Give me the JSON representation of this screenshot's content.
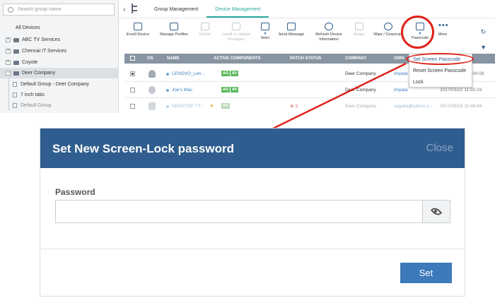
{
  "sidebar": {
    "search_placeholder": "Search group name",
    "all_devices": "All Devices",
    "groups": [
      "ABC TV Services",
      "Chennai IT Services",
      "Coyote",
      "Deer Company"
    ],
    "children": [
      "Default Group - Deer Company",
      "7 inch tabs",
      "Default Group"
    ]
  },
  "tabs": {
    "group": "Group Management",
    "device": "Device Management"
  },
  "toolbar": {
    "enroll": "Enroll Device",
    "manage": "Manage Profiles",
    "delete": "Delete",
    "install": "Install or Update Packages",
    "siren": "Siren",
    "send": "Send Message",
    "refresh": "Refresh Device Information",
    "assign": "Assign",
    "wipe": "Wipe / Corporate",
    "passcode": "Passcode",
    "more": "More"
  },
  "table": {
    "headers": [
      "OS",
      "NAME",
      "ACTIVE COMPONENTS",
      "PATCH STATUS",
      "COMPANY",
      "OWN"
    ],
    "rows": [
      {
        "name": "LENOVO_Len...",
        "company": "Deer Company",
        "owner": "Impala",
        "time": "34:08"
      },
      {
        "name": "Joe's Mac",
        "company": "Deer Company",
        "owner": "Impala",
        "time": "2017/03/22 11:35:29"
      },
      {
        "name": "DESKTOP-TT...",
        "patch": "3",
        "company": "Deer Company",
        "owner": "sagalla@yahoo.c...",
        "time": "2017/03/22 11:46:44"
      }
    ],
    "badges": {
      "ag": "AG",
      "av": "AV"
    }
  },
  "dropdown": [
    "Set Screen Passcode",
    "Reset Screen Passcode",
    "Lock"
  ],
  "modal": {
    "title": "Set New Screen-Lock password",
    "close": "Close",
    "password_label": "Password",
    "set_button": "Set"
  },
  "colors": {
    "accent": "#2aa8a0",
    "modal_header": "#2f5d8f",
    "button": "#3c7ab9",
    "highlight": "#e0211a"
  }
}
